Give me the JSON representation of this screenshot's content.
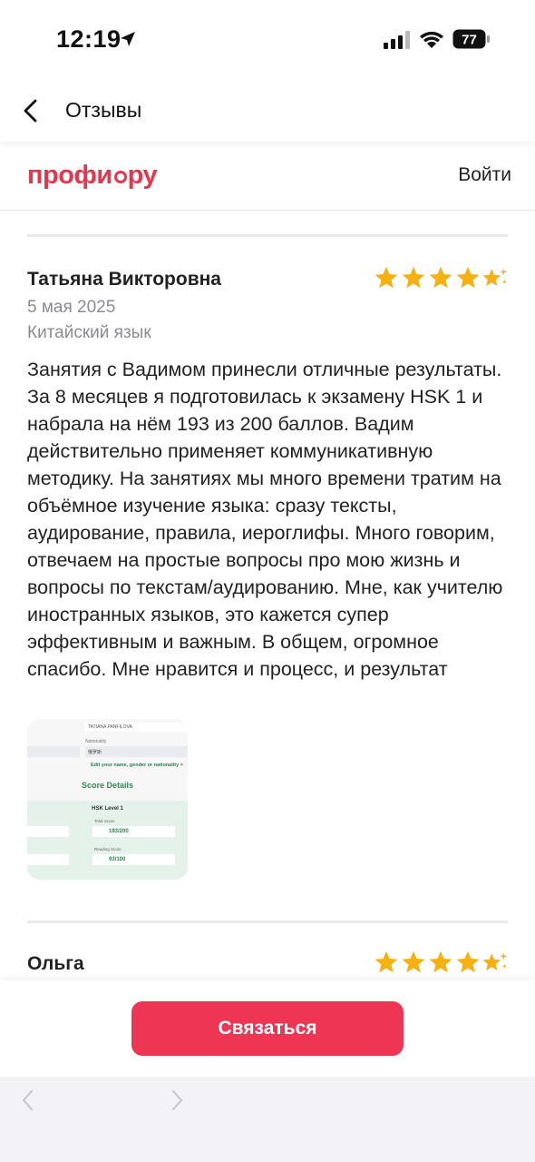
{
  "status_bar": {
    "time": "12:19",
    "battery": "77"
  },
  "header": {
    "title": "Отзывы"
  },
  "brand": {
    "logo_left": "профи",
    "logo_right": "ру",
    "login": "Войти",
    "color": "#e8364f"
  },
  "reviews": [
    {
      "name": "Татьяна Викторовна",
      "rating": 5,
      "date": "5 мая 2025",
      "subject": "Китайский язык",
      "text": "Занятия с Вадимом принесли отличные результаты. За 8 месяцев я подготовилась к экзамену HSK 1 и набрала на нём 193 из 200 баллов. Вадим действительно применяет коммуникативную методику. На занятиях мы много времени тратим на объёмное изучение языка: сразу тексты, аудирование, правила, иероглифы. Много говорим, отвечаем на простые вопросы про мою жизнь и вопросы по текстам/аудированию. Мне, как учителю иностранных языков, это кажется супер эффективным и важным. В общем, огромное спасибо. Мне нравится и процесс, и результат",
      "attachment": {
        "name_field": "TATIANA PANFILOVA",
        "nationality_label": "Nationality",
        "nationality_value": "俄罗斯",
        "edit_link": "Edit your name, gender or nationality >",
        "score_title": "Score Details",
        "level": "HSK Level 1",
        "total_label": "Total Score",
        "total_value": "193/200",
        "reading_label": "Reading Score",
        "reading_value": "93/100"
      }
    },
    {
      "name": "Ольга",
      "rating": 5
    }
  ],
  "action": {
    "contact_label": "Связаться",
    "button_color": "#ee3553"
  },
  "star_color": "#f5b014"
}
